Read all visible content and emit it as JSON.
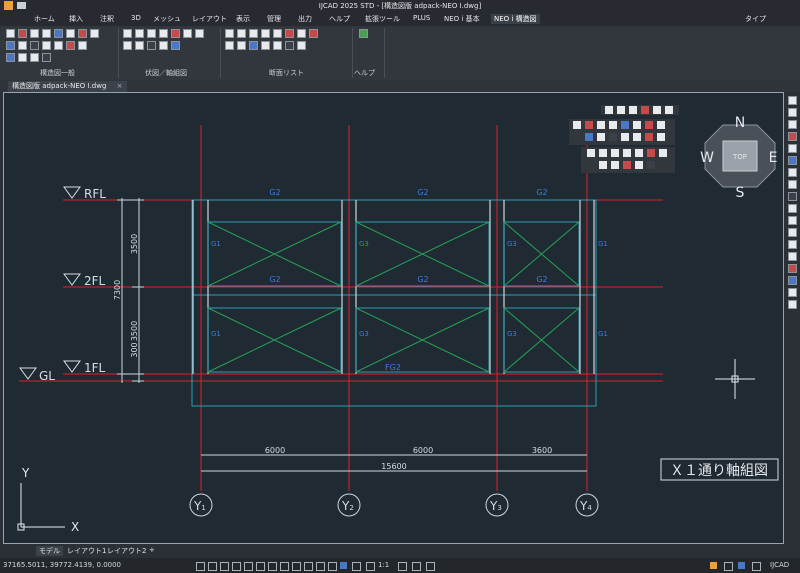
{
  "titlebar": {
    "title": "IJCAD 2025 STD - [構造図版 adpack-NEO I.dwg]"
  },
  "menu": {
    "items": [
      "ホーム",
      "挿入",
      "注釈",
      "3D",
      "メッシュ",
      "レイアウト",
      "表示",
      "管理",
      "出力",
      "ヘルプ",
      "拡張ツール",
      "PLUS",
      "NEO i 基本",
      "NEO i 構造図"
    ],
    "right": "タイプ"
  },
  "ribbon": {
    "panels": [
      "構造図一般",
      "伏図／軸組図",
      "断面リスト",
      "ヘルプ"
    ]
  },
  "doc": {
    "tab": "構造図版 adpack-NEO I.dwg",
    "close": "×"
  },
  "drawing": {
    "levels": [
      "RFL",
      "2FL",
      "1FL",
      "GL"
    ],
    "beams": {
      "top": [
        "G2",
        "G2",
        "G2"
      ],
      "mid": [
        "G2",
        "G2",
        "G2"
      ],
      "bottom": "FG2"
    },
    "columns": {
      "upper": [
        "G1",
        "G3",
        "G3",
        "G1"
      ],
      "lower": [
        "G1",
        "G3",
        "G3",
        "G1"
      ]
    },
    "dims_vertical": [
      "3500",
      "3500",
      "7300",
      "300"
    ],
    "dims_horizontal": [
      "6000",
      "6000",
      "3600"
    ],
    "dim_total": "15600",
    "axes": [
      "Y1",
      "Y2",
      "Y3",
      "Y4"
    ],
    "axis_main": "Y",
    "axis_sub": [
      "1",
      "2",
      "3",
      "4"
    ],
    "title": "Ｘ１通り軸組図"
  },
  "viewcube": {
    "top": "TOP",
    "n": "N",
    "s": "S",
    "e": "E",
    "w": "W"
  },
  "ucs": {
    "x": "X",
    "y": "Y"
  },
  "layouttabs": [
    "モデル",
    "レイアウト1",
    "レイアウト2",
    "+"
  ],
  "status": {
    "coords": "37165.5011, 39772.4139, 0.0000",
    "scale": "1:1",
    "app": "IJCAD"
  },
  "colors": {
    "red": "#e0202a",
    "cyan": "#2c9fb6",
    "green": "#26a05a",
    "blue": "#3c7be0",
    "bg": "#202a33"
  }
}
